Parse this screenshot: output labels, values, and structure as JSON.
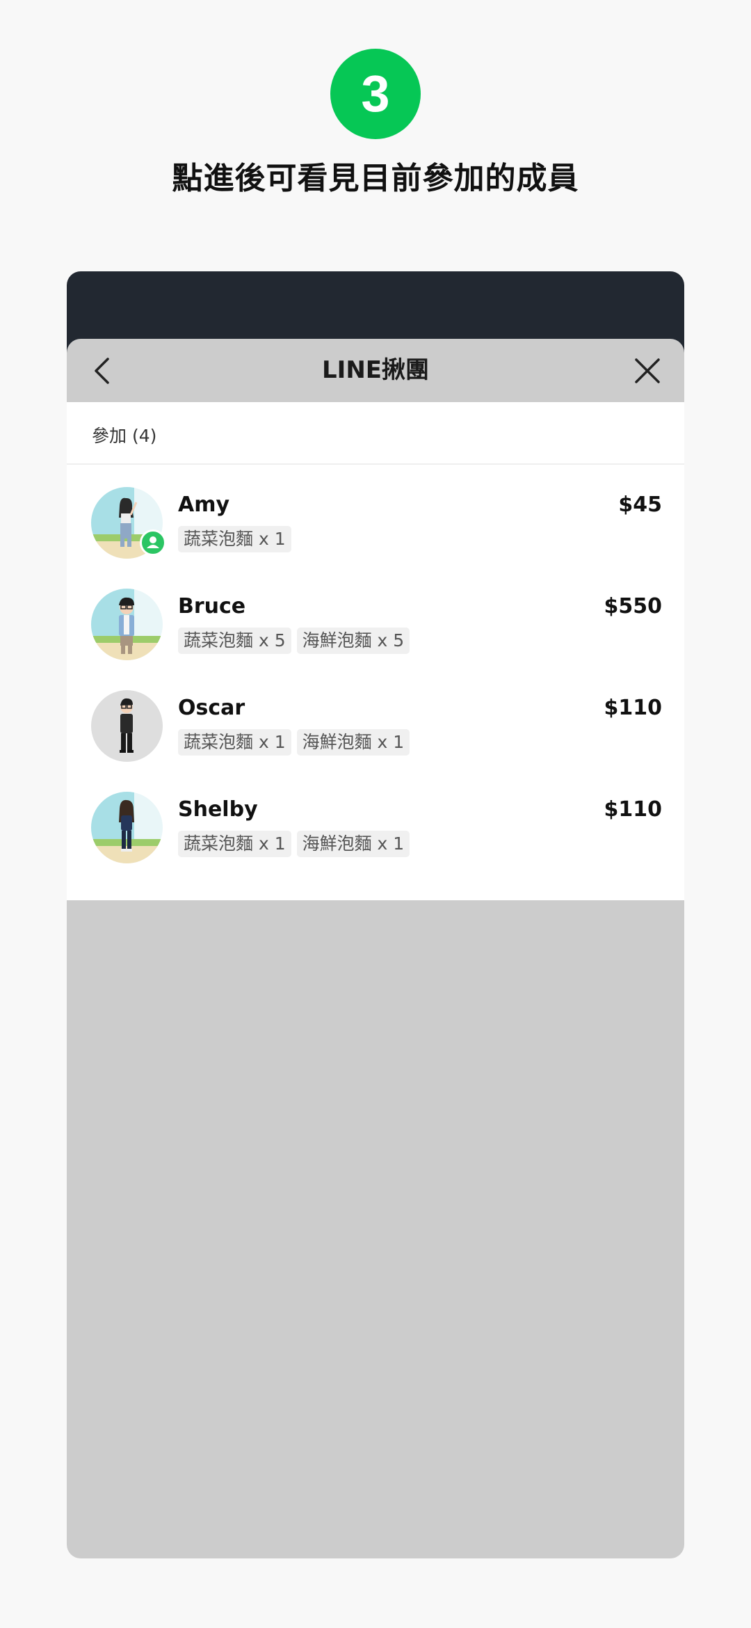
{
  "step": {
    "number": "3",
    "caption": "點進後可看見目前參加的成員",
    "badge_color": "#06c755"
  },
  "sheet": {
    "title": "LINE揪團",
    "back_icon": "chevron-left-icon",
    "close_icon": "close-icon"
  },
  "participants": {
    "label": "參加 (4)",
    "members": [
      {
        "name": "Amy",
        "amount": "$45",
        "is_friend": true,
        "items": [
          "蔬菜泡麵 x 1"
        ]
      },
      {
        "name": "Bruce",
        "amount": "$550",
        "is_friend": false,
        "items": [
          "蔬菜泡麵 x 5",
          "海鮮泡麵 x 5"
        ]
      },
      {
        "name": "Oscar",
        "amount": "$110",
        "is_friend": false,
        "items": [
          "蔬菜泡麵 x 1",
          "海鮮泡麵 x 1"
        ]
      },
      {
        "name": "Shelby",
        "amount": "$110",
        "is_friend": false,
        "items": [
          "蔬菜泡麵 x 1",
          "海鮮泡麵 x 1"
        ]
      }
    ]
  }
}
